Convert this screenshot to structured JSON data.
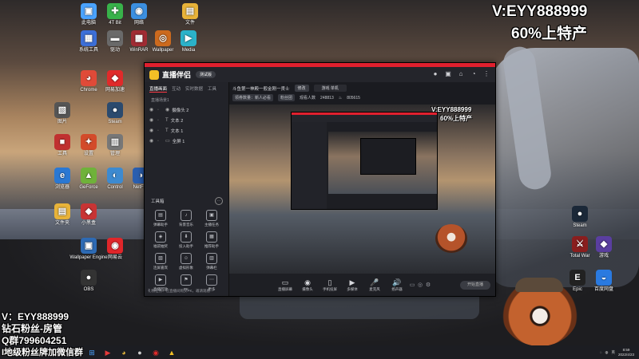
{
  "overlay": {
    "top_right_1": "V:EYY888999",
    "top_right_2": "60%上特产",
    "bottom_left_1": "V：EYY888999",
    "bottom_left_2": "钻石粉丝-房管",
    "bottom_left_3": "Q群799604251",
    "bottom_left_4": "I地级粉丝牌加微信群"
  },
  "desktop_icons": [
    {
      "label": "此电脑",
      "color": "#4aa3ff",
      "glyph": "▣"
    },
    {
      "label": "4T Bit",
      "color": "#38b24a",
      "glyph": "✚"
    },
    {
      "label": "网络",
      "color": "#3b8fe0",
      "glyph": "◉"
    },
    {
      "label": "文件",
      "color": "#e8b339",
      "glyph": "▤"
    },
    {
      "label": "系统工具",
      "color": "#3c6fd8",
      "glyph": "▦"
    },
    {
      "label": "驱动",
      "color": "#6a6a6a",
      "glyph": "▬"
    },
    {
      "label": "WinRAR",
      "color": "#a02b33",
      "glyph": "▩"
    },
    {
      "label": "Wallpaper",
      "color": "#cc6a1e",
      "glyph": "◎"
    },
    {
      "label": "Media",
      "color": "#2bb2c9",
      "glyph": "▶"
    },
    {
      "label": "Chrome",
      "color": "#e04a38",
      "glyph": "◕"
    },
    {
      "label": "网易加速",
      "color": "#e02a2a",
      "glyph": "◆"
    },
    {
      "label": "图片",
      "color": "#555",
      "glyph": "▧"
    },
    {
      "label": "Steam",
      "color": "#2b4a6e",
      "glyph": "●"
    },
    {
      "label": "工具",
      "color": "#c03030",
      "glyph": "■"
    },
    {
      "label": "设置",
      "color": "#d34b2a",
      "glyph": "✦"
    },
    {
      "label": "管理",
      "color": "#777",
      "glyph": "▥"
    },
    {
      "label": "浏览器",
      "color": "#2a78d3",
      "glyph": "e"
    },
    {
      "label": "GeForce",
      "color": "#6fb23a",
      "glyph": "▲"
    },
    {
      "label": "Control",
      "color": "#3d8ad0",
      "glyph": "◐"
    },
    {
      "label": "NetFlix",
      "color": "#2a5fb0",
      "glyph": "◑"
    },
    {
      "label": "文件夹",
      "color": "#e8b339",
      "glyph": "▤"
    },
    {
      "label": "小黑盒",
      "color": "#c83434",
      "glyph": "◆"
    },
    {
      "label": "Wallpaper Engine",
      "color": "#2d6ab4",
      "glyph": "▣"
    },
    {
      "label": "网易云",
      "color": "#e0262a",
      "glyph": "◉"
    },
    {
      "label": "OBS",
      "color": "#333",
      "glyph": "●"
    }
  ],
  "right_icons": [
    {
      "label": "Steam",
      "color": "#1b2838",
      "glyph": "●"
    },
    {
      "label": "Epic",
      "color": "#222",
      "glyph": "E"
    },
    {
      "label": "Total War",
      "color": "#8a1e1e",
      "glyph": "⚔"
    },
    {
      "label": "游戏",
      "color": "#5a3ea0",
      "glyph": "◆"
    },
    {
      "label": "百度网盘",
      "color": "#2a7ae0",
      "glyph": "◒"
    }
  ],
  "app": {
    "name": "直播伴侣",
    "badge": "测试版",
    "tabs": [
      "直播画面",
      "互动",
      "实时数据",
      "工具"
    ],
    "scene_head": "直播场景1",
    "layers": [
      {
        "name": "摄像头 2",
        "icon": "◉"
      },
      {
        "name": "文本 2",
        "icon": "T"
      },
      {
        "name": "文本 1",
        "icon": "T"
      },
      {
        "name": "全屏 1",
        "icon": "▭"
      }
    ],
    "tools_head": "工具箱",
    "tools": [
      {
        "label": "弹幕助手",
        "icon": "▤"
      },
      {
        "label": "背景音乐",
        "icon": "♪"
      },
      {
        "label": "主播任务",
        "icon": "▣"
      },
      {
        "label": "福袋抽奖",
        "icon": "◈"
      },
      {
        "label": "投入助手",
        "icon": "⬇"
      },
      {
        "label": "推荐助手",
        "icon": "▦"
      },
      {
        "label": "连屏嘉宾",
        "icon": "▧"
      },
      {
        "label": "虚拟形象",
        "icon": "☺"
      },
      {
        "label": "弹幕栏",
        "icon": "▥"
      },
      {
        "label": "直播回放",
        "icon": "▶"
      },
      {
        "label": "PK",
        "icon": "⚑"
      },
      {
        "label": "更多",
        "icon": "⋯"
      }
    ],
    "left_footer": "礼物任务：在直播间购买PK，邀请观看",
    "stream_title": "斗鱼第一神殿一般金刚一贤士",
    "edit_label": "修改",
    "category_label": "选择分区",
    "category_value": "游戏 单机",
    "audience_label": "观看人数",
    "audience_value": "248813",
    "heat_value": "805615",
    "tag1": "领券数量：新人必看",
    "tag2": "粉丝团",
    "controls": [
      {
        "label": "直播屏幕",
        "icon": "▭"
      },
      {
        "label": "摄像头",
        "icon": "◉"
      },
      {
        "label": "手机投屏",
        "icon": "▯"
      },
      {
        "label": "多媒体",
        "icon": "▶"
      },
      {
        "label": "麦克风",
        "icon": "🎤"
      },
      {
        "label": "扬声器",
        "icon": "🔊"
      }
    ],
    "start_live": "开始直播",
    "preview_ov1": "V:EYY888999",
    "preview_ov2": "60%上特产"
  },
  "taskbar": {
    "time": "8:59",
    "date": "2022/4/23"
  }
}
